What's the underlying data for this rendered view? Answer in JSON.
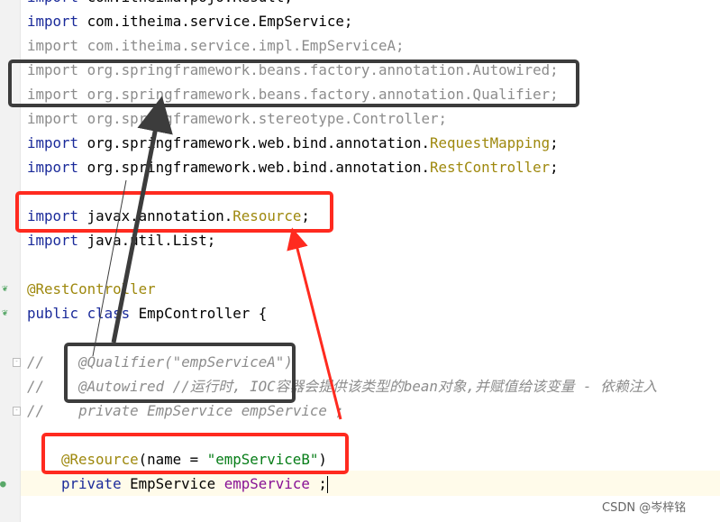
{
  "editor": {
    "lines": [
      {
        "kw": "import",
        "rest": " com.itheima.pojo.Result;",
        "dim": false
      },
      {
        "kw": "import",
        "rest": " com.itheima.service.EmpService;",
        "dim": false
      },
      {
        "kw": "import",
        "rest": " com.itheima.service.impl.EmpServiceA;",
        "dim": true
      },
      {
        "kw": "import",
        "rest": " org.springframework.beans.factory.annotation.Autowired;",
        "dim": true
      },
      {
        "kw": "import",
        "rest": " org.springframework.beans.factory.annotation.Qualifier;",
        "dim": true
      },
      {
        "kw": "import",
        "rest": " org.springframework.stereotype.Controller;",
        "dim": true
      }
    ],
    "import_rm_prefix": " org.springframework.web.bind.annotation.",
    "import_rm_class": "RequestMapping",
    "import_rc_class": "RestController",
    "import_kw": "import",
    "resource_prefix": " javax.annotation.",
    "resource_class": "Resource",
    "list_rest": " java.util.List;",
    "semicolon": ";",
    "rest_controller_annotation": "@RestController",
    "class_kw": "public class",
    "class_rest": " EmpController {",
    "comment_lines": [
      "//    @Qualifier(\"empServiceA\")",
      "//    @Autowired //运行时, IOC容器会提供该类型的bean对象,并赋值给该变量 - 依赖注入",
      "//    private EmpService empService ;"
    ],
    "resource_annotation": "@Resource",
    "resource_args_open": "(name = ",
    "resource_name": "\"empServiceB\"",
    "resource_args_close": ")",
    "field_kw": "private",
    "field_type": " EmpService ",
    "field_name": "empService",
    "field_end": " ;"
  },
  "annotations": {
    "highlight_colors": {
      "dark": "#3c3c3c",
      "red": "#ff2a1f"
    }
  },
  "watermark": "CSDN @岑梓铭"
}
